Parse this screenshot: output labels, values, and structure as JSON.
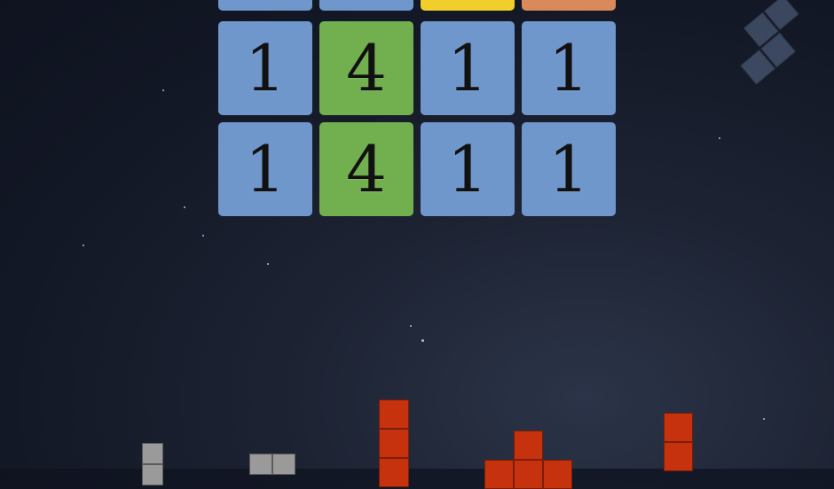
{
  "board": {
    "rows": [
      [
        "",
        "",
        "",
        ""
      ],
      [
        "1",
        "4",
        "1",
        "1"
      ],
      [
        "1",
        "4",
        "1",
        "1"
      ]
    ],
    "top_row_colors": [
      "blue",
      "blue",
      "yellow",
      "orange"
    ],
    "row_colors": [
      [
        "blue",
        "green",
        "blue",
        "blue"
      ],
      [
        "blue",
        "green",
        "blue",
        "blue"
      ]
    ]
  },
  "colors": {
    "blue": "#6f97cc",
    "green": "#72b04f",
    "yellow": "#f0cf2d",
    "orange": "#d98a5a",
    "red_block": "#c6320e",
    "gray_block": "#9a9a9a",
    "background": "#131826"
  }
}
